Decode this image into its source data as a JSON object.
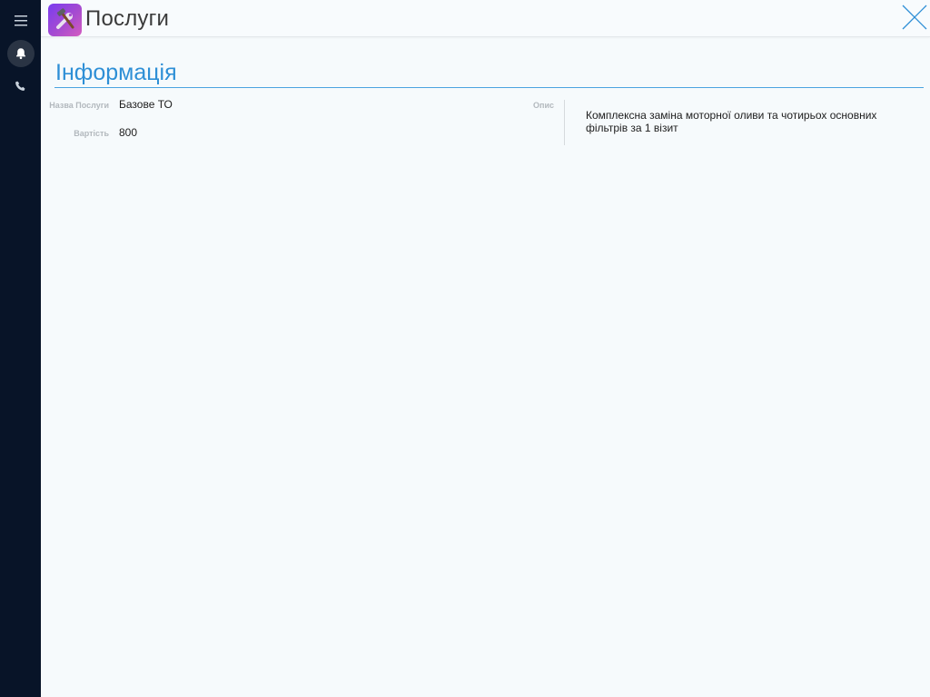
{
  "header": {
    "title": "Послуги",
    "app_icon": "tools-icon"
  },
  "sidebar": {
    "items": [
      {
        "icon": "menu-icon"
      },
      {
        "icon": "bell-icon"
      },
      {
        "icon": "phone-icon"
      }
    ]
  },
  "section": {
    "title": "Інформація"
  },
  "fields": {
    "name_label": "Назва Послуги",
    "name_value": "Базове ТО",
    "cost_label": "Вартість",
    "cost_value": "800",
    "description_label": "Опис",
    "description_value": "Комплексна заміна моторної оливи та чотирьох основних фільтрів за 1 візит"
  },
  "colors": {
    "sidebar_bg": "#081428",
    "accent": "#2e8fd6",
    "page_bg": "#f6fafc"
  }
}
